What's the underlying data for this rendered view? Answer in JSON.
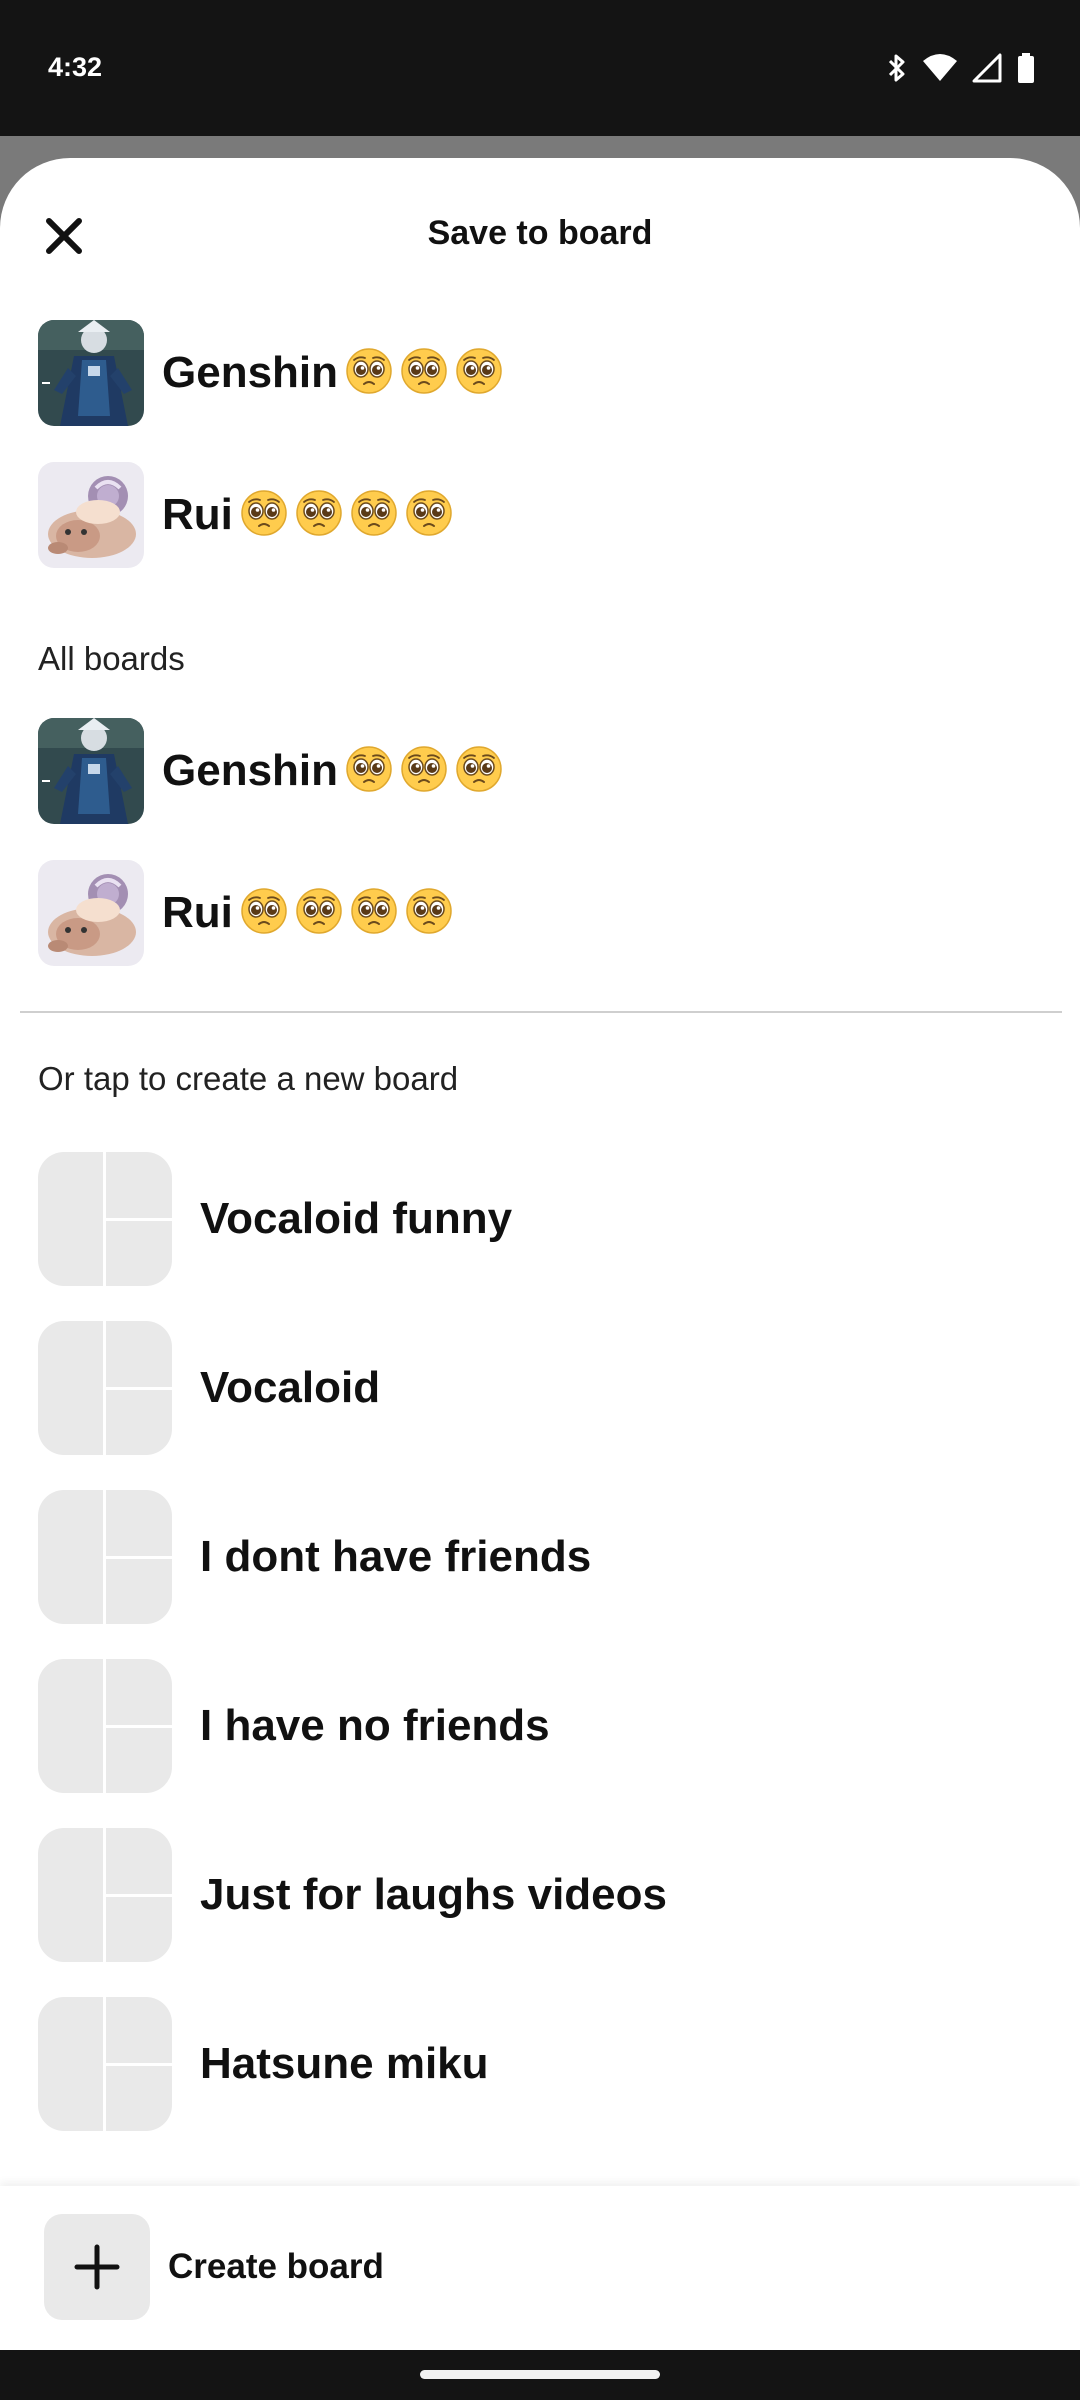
{
  "status_bar": {
    "time": "4:32",
    "icons": [
      "bluetooth-icon",
      "wifi-icon",
      "cell-signal-icon",
      "battery-icon"
    ]
  },
  "sheet": {
    "title": "Save to board",
    "close_icon": "close-icon"
  },
  "top_boards": [
    {
      "name": "Genshin",
      "emoji": "🥺🥺🥺",
      "thumbnail": "genshin-character-thumbnail"
    },
    {
      "name": "Rui",
      "emoji": "🥺🥺🥺🥺",
      "thumbnail": "plush-toy-thumbnail"
    }
  ],
  "all_boards": {
    "label": "All boards",
    "items": [
      {
        "name": "Genshin",
        "emoji": "🥺🥺🥺",
        "thumbnail": "genshin-character-thumbnail"
      },
      {
        "name": "Rui",
        "emoji": "🥺🥺🥺🥺",
        "thumbnail": "plush-toy-thumbnail"
      }
    ]
  },
  "suggestions": {
    "label": "Or tap to create a new board",
    "items": [
      {
        "name": "Vocaloid funny"
      },
      {
        "name": "Vocaloid"
      },
      {
        "name": "I dont have friends"
      },
      {
        "name": "I have no friends"
      },
      {
        "name": "Just for laughs videos"
      },
      {
        "name": "Hatsune miku"
      }
    ]
  },
  "footer": {
    "create_label": "Create board",
    "icon": "plus-icon"
  },
  "colors": {
    "status_bar_bg": "#141414",
    "scrim": "#7a7a7a",
    "placeholder": "#e9e9e9",
    "text": "#111111"
  }
}
